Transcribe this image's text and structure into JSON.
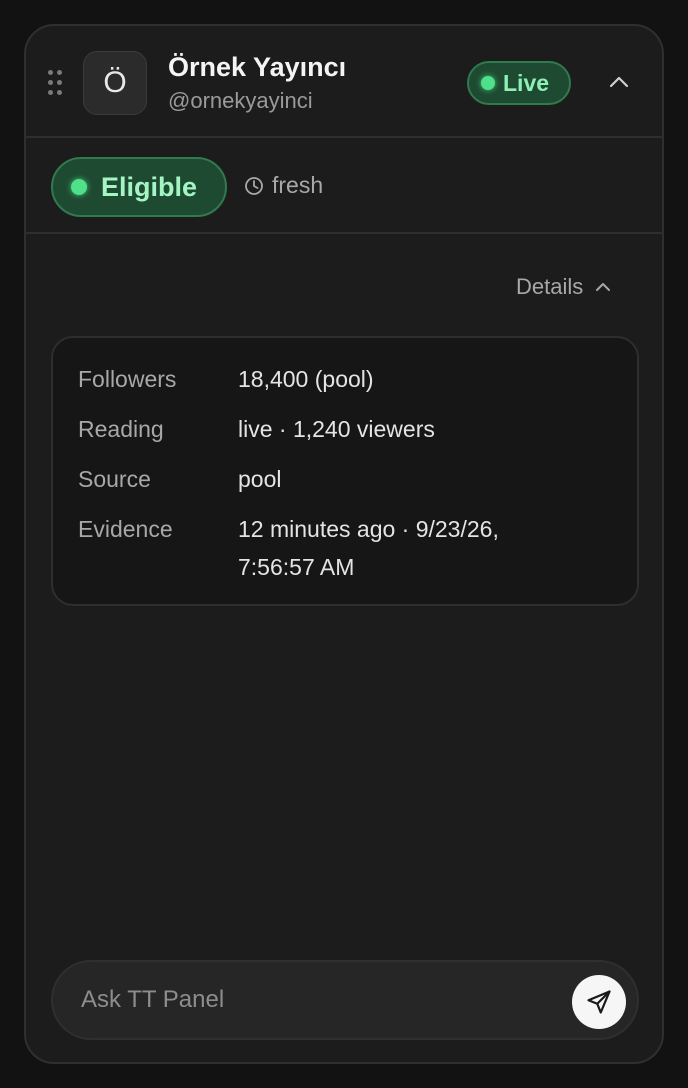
{
  "header": {
    "avatar_letter": "Ö",
    "name": "Örnek Yayıncı",
    "handle": "@ornekyayinci",
    "live_label": "Live",
    "icons": {
      "drag": "drag-handle-icon",
      "collapse": "chevron-up-icon"
    }
  },
  "status": {
    "eligible_label": "Eligible",
    "freshness_label": "fresh",
    "icons": {
      "freshness": "clock-icon"
    }
  },
  "details": {
    "toggle_label": "Details",
    "rows": [
      {
        "label": "Followers",
        "value": "18,400 (pool)"
      },
      {
        "label": "Reading",
        "value": "live · 1,240 viewers"
      },
      {
        "label": "Source",
        "value": "pool"
      },
      {
        "label": "Evidence",
        "value": "12 minutes ago · 9/23/26, 7:56:57 AM"
      }
    ]
  },
  "ask": {
    "placeholder": "Ask TT Panel",
    "value": "",
    "icons": {
      "send": "send-icon"
    }
  },
  "colors": {
    "status_green": "#4fe08a",
    "badge_bg": "#1f4a32",
    "panel_bg": "#1c1c1c"
  }
}
